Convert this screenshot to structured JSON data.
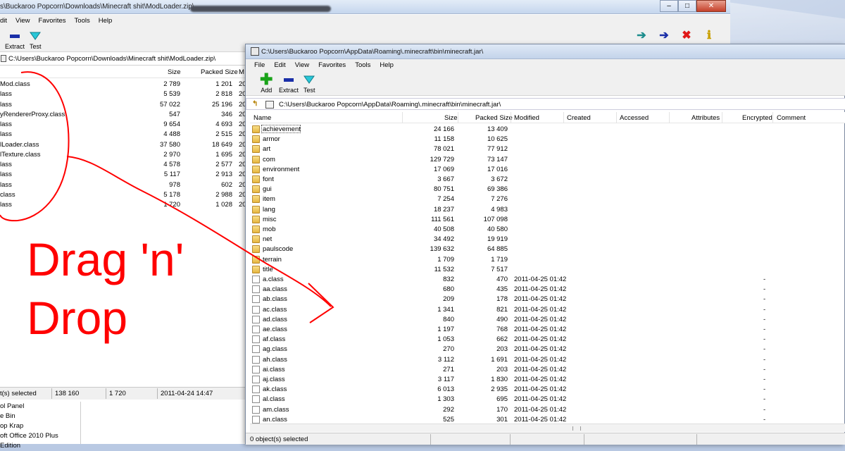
{
  "back_window": {
    "title": "s\\Buckaroo Popcorn\\Downloads\\Minecraft shit\\ModLoader.zip\\",
    "menu": [
      "dit",
      "View",
      "Favorites",
      "Tools",
      "Help"
    ],
    "toolbar": {
      "extract": "Extract",
      "test": "Test"
    },
    "path": "C:\\Users\\Buckaroo Popcorn\\Downloads\\Minecraft shit\\ModLoader.zip\\",
    "columns": {
      "size": "Size",
      "packed": "Packed Size",
      "modified_partial": "M"
    },
    "rows": [
      {
        "name": "Mod.class",
        "size": "2 789",
        "packed": "1 201",
        "mod": "20"
      },
      {
        "name": "lass",
        "size": "5 539",
        "packed": "2 818",
        "mod": "20"
      },
      {
        "name": "lass",
        "size": "57 022",
        "packed": "25 196",
        "mod": "20"
      },
      {
        "name": "yRendererProxy.class",
        "size": "547",
        "packed": "346",
        "mod": "20"
      },
      {
        "name": "lass",
        "size": "9 654",
        "packed": "4 693",
        "mod": "20"
      },
      {
        "name": "lass",
        "size": "4 488",
        "packed": "2 515",
        "mod": "20"
      },
      {
        "name": "lLoader.class",
        "size": "37 580",
        "packed": "18 649",
        "mod": "20"
      },
      {
        "name": "lTexture.class",
        "size": "2 970",
        "packed": "1 695",
        "mod": "20"
      },
      {
        "name": "lass",
        "size": "4 578",
        "packed": "2 577",
        "mod": "20"
      },
      {
        "name": "lass",
        "size": "5 117",
        "packed": "2 913",
        "mod": "20"
      },
      {
        "name": "lass",
        "size": "978",
        "packed": "602",
        "mod": "20"
      },
      {
        "name": "class",
        "size": "5 178",
        "packed": "2 988",
        "mod": "20"
      },
      {
        "name": "lass",
        "size": "1 720",
        "packed": "1 028",
        "mod": "20"
      }
    ],
    "status": {
      "selected": "t(s) selected",
      "size": "138 160",
      "packed": "1 720",
      "date": "2011-04-24 14:47"
    },
    "explorer": [
      "ol Panel",
      "e Bin",
      "op Krap",
      "oft Office 2010 Plus Edition"
    ]
  },
  "front_window": {
    "title": "C:\\Users\\Buckaroo Popcorn\\AppData\\Roaming\\.minecraft\\bin\\minecraft.jar\\",
    "menu": [
      "File",
      "Edit",
      "View",
      "Favorites",
      "Tools",
      "Help"
    ],
    "toolbar": {
      "add": "Add",
      "extract": "Extract",
      "test": "Test"
    },
    "path": "C:\\Users\\Buckaroo Popcorn\\AppData\\Roaming\\.minecraft\\bin\\minecraft.jar\\",
    "columns": [
      "Name",
      "Size",
      "Packed Size",
      "Modified",
      "Created",
      "Accessed",
      "Attributes",
      "Encrypted",
      "Comment"
    ],
    "rows": [
      {
        "name": "achievement",
        "type": "folder",
        "size": "24 166",
        "packed": "13 409",
        "modified": "",
        "enc": ""
      },
      {
        "name": "armor",
        "type": "folder",
        "size": "11 158",
        "packed": "10 625",
        "modified": "",
        "enc": ""
      },
      {
        "name": "art",
        "type": "folder",
        "size": "78 021",
        "packed": "77 912",
        "modified": "",
        "enc": ""
      },
      {
        "name": "com",
        "type": "folder",
        "size": "129 729",
        "packed": "73 147",
        "modified": "",
        "enc": ""
      },
      {
        "name": "environment",
        "type": "folder",
        "size": "17 069",
        "packed": "17 016",
        "modified": "",
        "enc": ""
      },
      {
        "name": "font",
        "type": "folder",
        "size": "3 667",
        "packed": "3 672",
        "modified": "",
        "enc": ""
      },
      {
        "name": "gui",
        "type": "folder",
        "size": "80 751",
        "packed": "69 386",
        "modified": "",
        "enc": ""
      },
      {
        "name": "item",
        "type": "folder",
        "size": "7 254",
        "packed": "7 276",
        "modified": "",
        "enc": ""
      },
      {
        "name": "lang",
        "type": "folder",
        "size": "18 237",
        "packed": "4 983",
        "modified": "",
        "enc": ""
      },
      {
        "name": "misc",
        "type": "folder",
        "size": "111 561",
        "packed": "107 098",
        "modified": "",
        "enc": ""
      },
      {
        "name": "mob",
        "type": "folder",
        "size": "40 508",
        "packed": "40 580",
        "modified": "",
        "enc": ""
      },
      {
        "name": "net",
        "type": "folder",
        "size": "34 492",
        "packed": "19 919",
        "modified": "",
        "enc": ""
      },
      {
        "name": "paulscode",
        "type": "folder",
        "size": "139 632",
        "packed": "64 885",
        "modified": "",
        "enc": ""
      },
      {
        "name": "terrain",
        "type": "folder",
        "size": "1 709",
        "packed": "1 719",
        "modified": "",
        "enc": ""
      },
      {
        "name": "title",
        "type": "folder",
        "size": "11 532",
        "packed": "7 517",
        "modified": "",
        "enc": ""
      },
      {
        "name": "a.class",
        "type": "file",
        "size": "832",
        "packed": "470",
        "modified": "2011-04-25 01:42",
        "enc": "-"
      },
      {
        "name": "aa.class",
        "type": "file",
        "size": "680",
        "packed": "435",
        "modified": "2011-04-25 01:42",
        "enc": "-"
      },
      {
        "name": "ab.class",
        "type": "file",
        "size": "209",
        "packed": "178",
        "modified": "2011-04-25 01:42",
        "enc": "-"
      },
      {
        "name": "ac.class",
        "type": "file",
        "size": "1 341",
        "packed": "821",
        "modified": "2011-04-25 01:42",
        "enc": "-"
      },
      {
        "name": "ad.class",
        "type": "file",
        "size": "840",
        "packed": "490",
        "modified": "2011-04-25 01:42",
        "enc": "-"
      },
      {
        "name": "ae.class",
        "type": "file",
        "size": "1 197",
        "packed": "768",
        "modified": "2011-04-25 01:42",
        "enc": "-"
      },
      {
        "name": "af.class",
        "type": "file",
        "size": "1 053",
        "packed": "662",
        "modified": "2011-04-25 01:42",
        "enc": "-"
      },
      {
        "name": "ag.class",
        "type": "file",
        "size": "270",
        "packed": "203",
        "modified": "2011-04-25 01:42",
        "enc": "-"
      },
      {
        "name": "ah.class",
        "type": "file",
        "size": "3 112",
        "packed": "1 691",
        "modified": "2011-04-25 01:42",
        "enc": "-"
      },
      {
        "name": "ai.class",
        "type": "file",
        "size": "271",
        "packed": "203",
        "modified": "2011-04-25 01:42",
        "enc": "-"
      },
      {
        "name": "aj.class",
        "type": "file",
        "size": "3 117",
        "packed": "1 830",
        "modified": "2011-04-25 01:42",
        "enc": "-"
      },
      {
        "name": "ak.class",
        "type": "file",
        "size": "6 013",
        "packed": "2 935",
        "modified": "2011-04-25 01:42",
        "enc": "-"
      },
      {
        "name": "al.class",
        "type": "file",
        "size": "1 303",
        "packed": "695",
        "modified": "2011-04-25 01:42",
        "enc": "-"
      },
      {
        "name": "am.class",
        "type": "file",
        "size": "292",
        "packed": "170",
        "modified": "2011-04-25 01:42",
        "enc": "-"
      },
      {
        "name": "an.class",
        "type": "file",
        "size": "525",
        "packed": "301",
        "modified": "2011-04-25 01:42",
        "enc": "-"
      }
    ],
    "status": "0 object(s) selected"
  },
  "annotation": {
    "line1": "Drag 'n'",
    "line2": "Drop",
    "color": "#ff0000"
  },
  "colors": {
    "extract_blue": "#1a2fa8",
    "add_green": "#19a319",
    "test_cyan": "#29c7d8",
    "delete_red": "#e01818"
  }
}
